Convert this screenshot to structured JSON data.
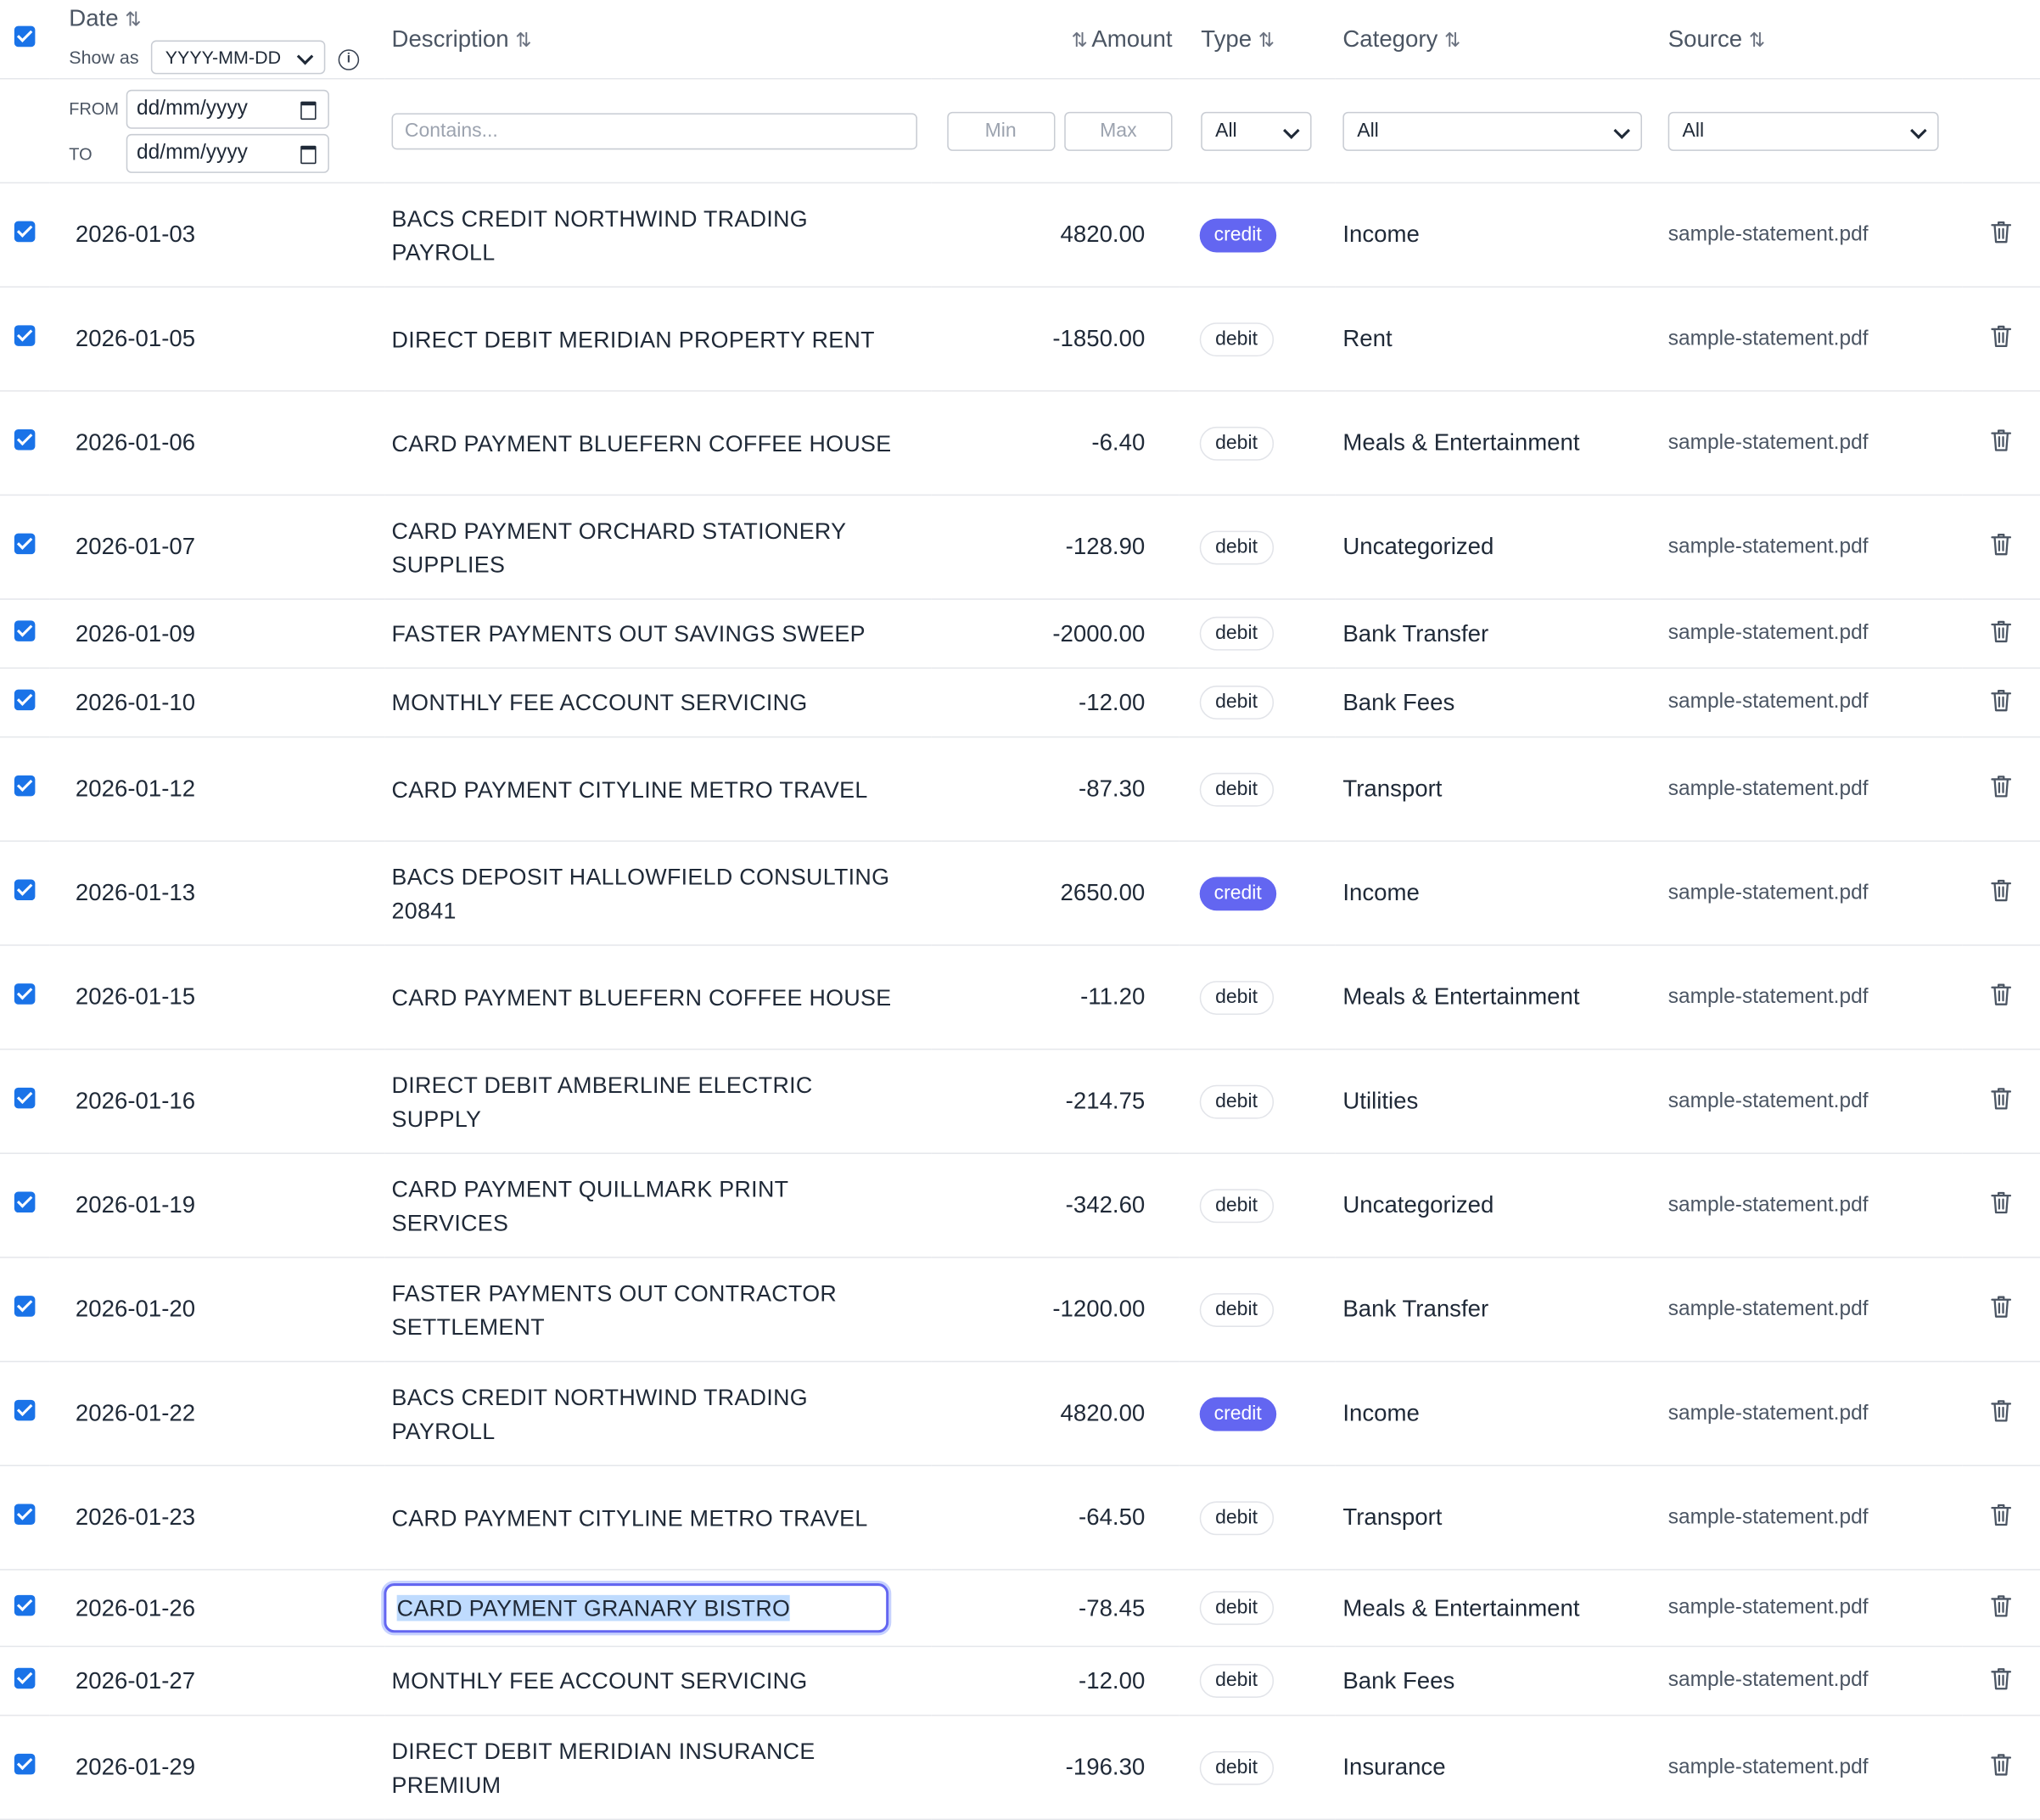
{
  "header": {
    "date_label": "Date",
    "show_as_label": "Show as",
    "date_format": "YYYY-MM-DD",
    "description_label": "Description",
    "amount_label": "Amount",
    "type_label": "Type",
    "category_label": "Category",
    "source_label": "Source",
    "sort_glyph": "⇅"
  },
  "filters": {
    "from_label": "FROM",
    "to_label": "TO",
    "from_placeholder": "dd/mm/yyyy",
    "to_placeholder": "dd/mm/yyyy",
    "description_placeholder": "Contains...",
    "min_placeholder": "Min",
    "max_placeholder": "Max",
    "type_value": "All",
    "category_value": "All",
    "source_value": "All"
  },
  "rows": [
    {
      "date": "2026-01-03",
      "description": "BACS CREDIT NORTHWIND TRADING PAYROLL",
      "amount": "4820.00",
      "type": "credit",
      "category": "Income",
      "source": "sample-statement.pdf"
    },
    {
      "date": "2026-01-05",
      "description": "DIRECT DEBIT MERIDIAN PROPERTY RENT",
      "amount": "-1850.00",
      "type": "debit",
      "category": "Rent",
      "source": "sample-statement.pdf"
    },
    {
      "date": "2026-01-06",
      "description": "CARD PAYMENT BLUEFERN COFFEE HOUSE",
      "amount": "-6.40",
      "type": "debit",
      "category": "Meals & Entertainment",
      "source": "sample-statement.pdf"
    },
    {
      "date": "2026-01-07",
      "description": "CARD PAYMENT ORCHARD STATIONERY SUPPLIES",
      "amount": "-128.90",
      "type": "debit",
      "category": "Uncategorized",
      "source": "sample-statement.pdf"
    },
    {
      "date": "2026-01-09",
      "description": "FASTER PAYMENTS OUT SAVINGS SWEEP",
      "amount": "-2000.00",
      "type": "debit",
      "category": "Bank Transfer",
      "source": "sample-statement.pdf"
    },
    {
      "date": "2026-01-10",
      "description": "MONTHLY FEE ACCOUNT SERVICING",
      "amount": "-12.00",
      "type": "debit",
      "category": "Bank Fees",
      "source": "sample-statement.pdf"
    },
    {
      "date": "2026-01-12",
      "description": "CARD PAYMENT CITYLINE METRO TRAVEL",
      "amount": "-87.30",
      "type": "debit",
      "category": "Transport",
      "source": "sample-statement.pdf"
    },
    {
      "date": "2026-01-13",
      "description": "BACS DEPOSIT HALLOWFIELD CONSULTING 20841",
      "amount": "2650.00",
      "type": "credit",
      "category": "Income",
      "source": "sample-statement.pdf"
    },
    {
      "date": "2026-01-15",
      "description": "CARD PAYMENT BLUEFERN COFFEE HOUSE",
      "amount": "-11.20",
      "type": "debit",
      "category": "Meals & Entertainment",
      "source": "sample-statement.pdf"
    },
    {
      "date": "2026-01-16",
      "description": "DIRECT DEBIT AMBERLINE ELECTRIC SUPPLY",
      "amount": "-214.75",
      "type": "debit",
      "category": "Utilities",
      "source": "sample-statement.pdf"
    },
    {
      "date": "2026-01-19",
      "description": "CARD PAYMENT QUILLMARK PRINT SERVICES",
      "amount": "-342.60",
      "type": "debit",
      "category": "Uncategorized",
      "source": "sample-statement.pdf"
    },
    {
      "date": "2026-01-20",
      "description": "FASTER PAYMENTS OUT CONTRACTOR SETTLEMENT",
      "amount": "-1200.00",
      "type": "debit",
      "category": "Bank Transfer",
      "source": "sample-statement.pdf"
    },
    {
      "date": "2026-01-22",
      "description": "BACS CREDIT NORTHWIND TRADING PAYROLL",
      "amount": "4820.00",
      "type": "credit",
      "category": "Income",
      "source": "sample-statement.pdf"
    },
    {
      "date": "2026-01-23",
      "description": "CARD PAYMENT CITYLINE METRO TRAVEL",
      "amount": "-64.50",
      "type": "debit",
      "category": "Transport",
      "source": "sample-statement.pdf"
    },
    {
      "date": "2026-01-26",
      "description": "CARD PAYMENT GRANARY BISTRO",
      "amount": "-78.45",
      "type": "debit",
      "category": "Meals & Entertainment",
      "source": "sample-statement.pdf",
      "editing": true
    },
    {
      "date": "2026-01-27",
      "description": "MONTHLY FEE ACCOUNT SERVICING",
      "amount": "-12.00",
      "type": "debit",
      "category": "Bank Fees",
      "source": "sample-statement.pdf"
    },
    {
      "date": "2026-01-29",
      "description": "DIRECT DEBIT MERIDIAN INSURANCE PREMIUM",
      "amount": "-196.30",
      "type": "debit",
      "category": "Insurance",
      "source": "sample-statement.pdf"
    }
  ],
  "colors": {
    "accent": "#1a73e8",
    "credit_badge": "#6366f1",
    "edit_ring": "#6366f1"
  },
  "icons": {
    "row_delete": "trash-icon",
    "select": "checkbox-checked-icon",
    "sort": "sort-icon",
    "info": "info-icon",
    "calendar": "calendar-icon"
  }
}
